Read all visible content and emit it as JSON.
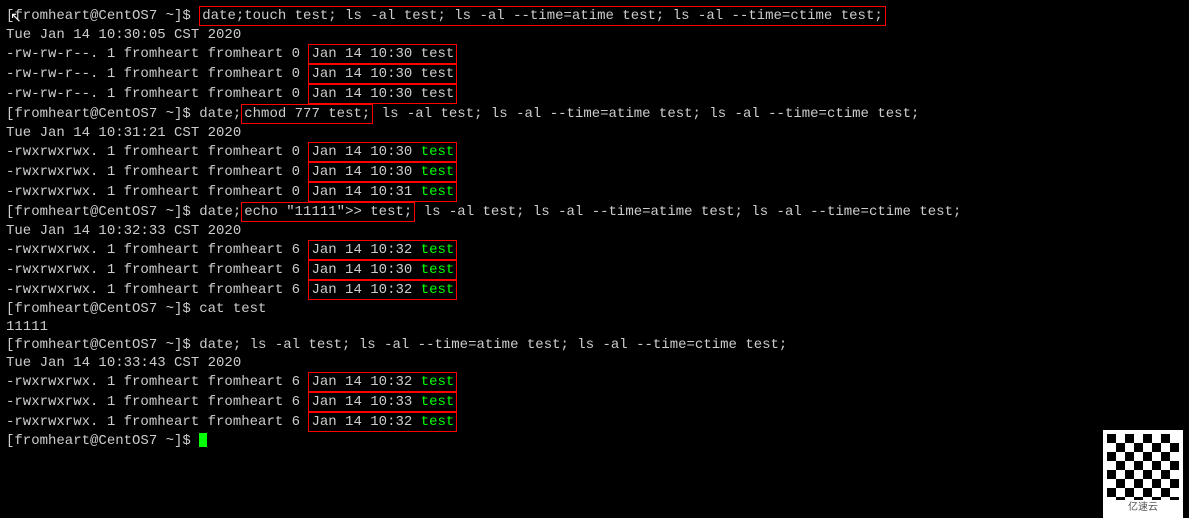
{
  "prompt": "[fromheart@CentOS7 ~]$ ",
  "cmd1": "date;touch test; ls -al test; ls -al --time=atime test; ls -al --time=ctime test;",
  "date1": "Tue Jan 14 10:30:05 CST 2020",
  "ls1_perm": "-rw-rw-r--. 1 fromheart fromheart 0 ",
  "ls1_time1": "Jan 14 10:30 test",
  "ls1_time2": "Jan 14 10:30 test",
  "ls1_time3": "Jan 14 10:30 test",
  "cmd2_pre": "date;",
  "cmd2_box": "chmod 777 test;",
  "cmd2_post": " ls -al test; ls -al --time=atime test; ls -al --time=ctime test;",
  "date2": "Tue Jan 14 10:31:21 CST 2020",
  "ls2_perm": "-rwxrwxrwx. 1 fromheart fromheart 0 ",
  "ls2_time1": "Jan 14 10:30 ",
  "ls2_time2": "Jan 14 10:30 ",
  "ls2_time3": "Jan 14 10:31 ",
  "test_green": "test",
  "cmd3_pre": "date;",
  "cmd3_box": "echo \"11111\">> test;",
  "cmd3_post": " ls -al test; ls -al --time=atime test; ls -al --time=ctime test;",
  "date3": "Tue Jan 14 10:32:33 CST 2020",
  "ls3_perm": "-rwxrwxrwx. 1 fromheart fromheart 6 ",
  "ls3_time1": "Jan 14 10:32 ",
  "ls3_time2": "Jan 14 10:30 ",
  "ls3_time3": "Jan 14 10:32 ",
  "cmd4": "cat test",
  "cat_out": "11111",
  "cmd5": "date; ls -al test; ls -al --time=atime test; ls -al --time=ctime test;",
  "date5": "Tue Jan 14 10:33:43 CST 2020",
  "ls5_perm": "-rwxrwxrwx. 1 fromheart fromheart 6 ",
  "ls5_time1": "Jan 14 10:32 ",
  "ls5_time2": "Jan 14 10:33 ",
  "ls5_time3": "Jan 14 10:32 ",
  "watermark": "亿速云"
}
